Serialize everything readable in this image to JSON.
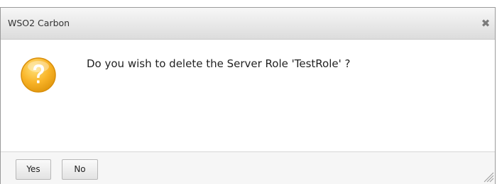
{
  "dialog": {
    "title": "WSO2 Carbon",
    "close_icon": "close-icon",
    "message": "Do you wish to delete the Server Role 'TestRole' ?",
    "icon": "question-icon",
    "buttons": {
      "yes_label": "Yes",
      "no_label": "No"
    }
  },
  "colors": {
    "icon_fill": "#f9b428",
    "icon_highlight": "#ffe27a",
    "titlebar_top": "#f7f7f7",
    "titlebar_bottom": "#dcdcdc"
  }
}
